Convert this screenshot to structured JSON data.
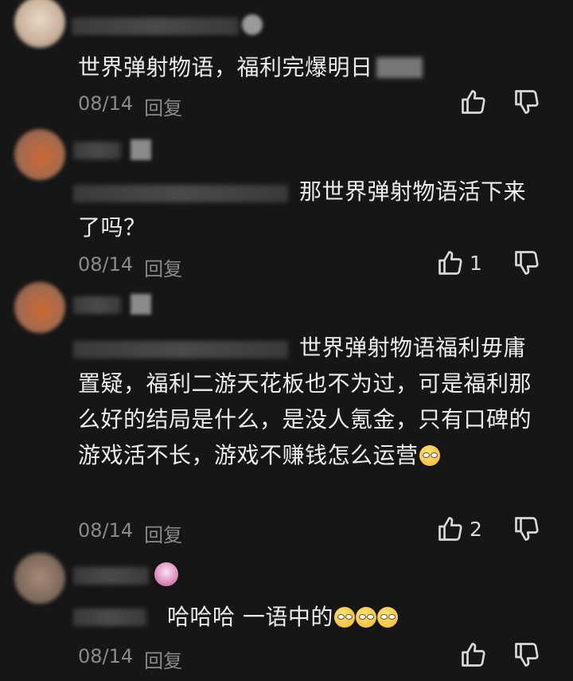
{
  "comments": [
    {
      "text": "世界弹射物语，福利完爆明日",
      "date": "08/14",
      "reply": "回复",
      "likes": ""
    },
    {
      "text": "那世界弹射物语活下来了吗？",
      "date": "08/14",
      "reply": "回复",
      "likes": "1"
    },
    {
      "text": "世界弹射物语福利毋庸置疑，福利二游天花板也不为过，可是福利那么好的结局是什么，是没人氪金，只有口碑的游戏活不长，游戏不赚钱怎么运营",
      "date": "08/14",
      "reply": "回复",
      "likes": "2"
    },
    {
      "text": "哈哈哈 一语中的",
      "date": "08/14",
      "reply": "回复",
      "likes": ""
    }
  ],
  "icons": {
    "like": "thumbs-up-icon",
    "dislike": "thumbs-down-icon"
  },
  "colors": {
    "background": "#161616",
    "text": "#ececec",
    "meta": "#8a8a8a"
  }
}
